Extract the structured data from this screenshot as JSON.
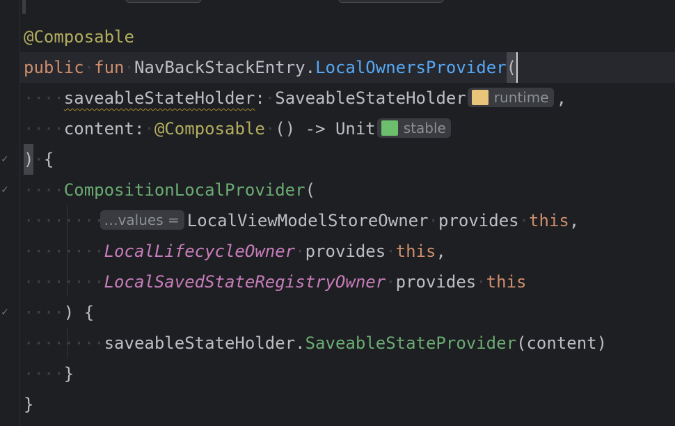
{
  "editor": {
    "annotation": "@Composable",
    "signature": {
      "kw_public": "public",
      "kw_fun": "fun",
      "receiver": "NavBackStackEntry",
      "dot": ".",
      "name": "LocalOwnersProvider",
      "paren": "("
    },
    "param1": {
      "name": "saveableStateHolder",
      "colon": ":",
      "type": "SaveableStateHolder",
      "hint": "runtime",
      "hint_color": "#e8c57a",
      "trail": ","
    },
    "param2": {
      "name": "content",
      "colon": ":",
      "annotation": "@Composable",
      "type_rest": "() -> Unit",
      "hint": "stable",
      "hint_color": "#6cbf6c"
    },
    "close_sig": ")",
    "open_brace": "{",
    "call_name": "CompositionLocalProvider",
    "call_paren": "(",
    "values_hint": "…values =",
    "arg1": {
      "owner": "LocalViewModelStoreOwner",
      "provides": "provides",
      "this": "this",
      "comma": ","
    },
    "arg2": {
      "owner": "LocalLifecycleOwner",
      "provides": "provides",
      "this": "this",
      "comma": ","
    },
    "arg3": {
      "owner": "LocalSavedStateRegistryOwner",
      "provides": "provides",
      "this": "this"
    },
    "close_call": ") {",
    "inner": {
      "receiver": "saveableStateHolder",
      "dot": ".",
      "method": "SaveableStateProvider",
      "args": "(content)"
    },
    "close_inner": "}",
    "close_fn": "}",
    "gutter_check": "✓"
  }
}
